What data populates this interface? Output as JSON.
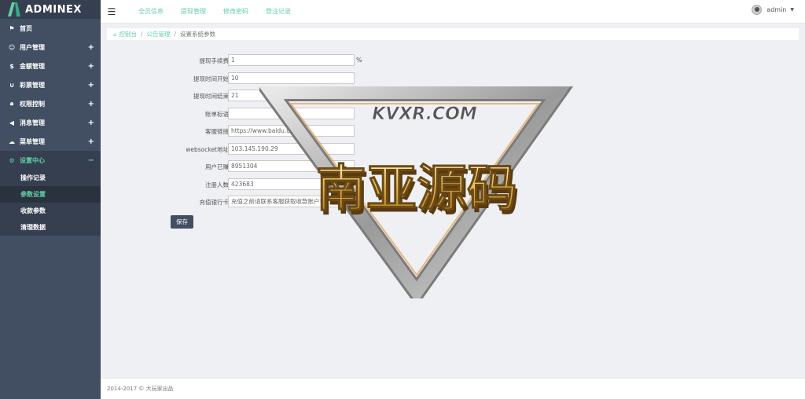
{
  "app": {
    "logo_text": "ADMINEX"
  },
  "sidebar": {
    "items": [
      {
        "label": "首页",
        "icon": "flag-icon"
      },
      {
        "label": "用户管理",
        "icon": "user-circle-icon"
      },
      {
        "label": "金额管理",
        "icon": "dollar-icon"
      },
      {
        "label": "彩票管理",
        "icon": "magnet-icon"
      },
      {
        "label": "权限控制",
        "icon": "lock-icon"
      },
      {
        "label": "消息管理",
        "icon": "bullhorn-icon"
      },
      {
        "label": "菜单管理",
        "icon": "cloud-icon"
      },
      {
        "label": "设置中心",
        "icon": "gear-icon"
      }
    ],
    "subitems": [
      {
        "label": "操作记录"
      },
      {
        "label": "参数设置"
      },
      {
        "label": "收款参数"
      },
      {
        "label": "清理数据"
      }
    ]
  },
  "topbar": {
    "links": [
      "全员信息",
      "提现管理",
      "修改密码",
      "登注记录"
    ],
    "username": "admin"
  },
  "breadcrumb": {
    "home": "控制台",
    "section": "公告管理",
    "current": "设置系统参数"
  },
  "form": {
    "fields": [
      {
        "label": "提现手续费",
        "value": "1",
        "unit": "%"
      },
      {
        "label": "提现时间开始",
        "value": "10"
      },
      {
        "label": "提现时间结束",
        "value": "21"
      },
      {
        "label": "账单标语",
        "value": ""
      },
      {
        "label": "客服链接",
        "value": "https://www.baidu.com"
      },
      {
        "label": "websocket地址",
        "value": "103.145.190.29"
      },
      {
        "label": "用户已赚",
        "value": "8951304"
      },
      {
        "label": "注册人数",
        "value": "423683"
      },
      {
        "label": "充值银行卡",
        "value": "充值之前请联系客服获取收款账户!"
      }
    ],
    "save_label": "保存"
  },
  "footer": {
    "text": "2014-2017 © 大玩家出品"
  },
  "watermark": {
    "domain": "KVXR.COM",
    "title": "南亚源码"
  },
  "colors": {
    "sidebar_bg": "#424f63",
    "accent": "#65cea7",
    "content_bg": "#eff0f4"
  }
}
